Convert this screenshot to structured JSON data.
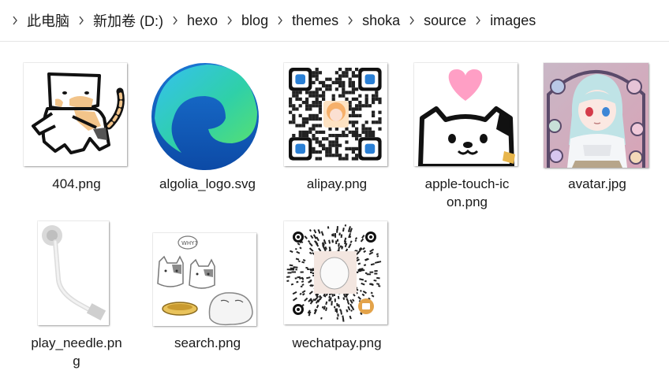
{
  "breadcrumb": [
    "此电脑",
    "新加卷 (D:)",
    "hexo",
    "blog",
    "themes",
    "shoka",
    "source",
    "images"
  ],
  "files": [
    {
      "name": "404.png"
    },
    {
      "name": "algolia_logo.svg"
    },
    {
      "name": "alipay.png"
    },
    {
      "name_line1": "apple-touch-ic",
      "name_line2": "on.png"
    },
    {
      "name": "avatar.jpg"
    },
    {
      "name_line1": "play_needle.pn",
      "name_line2": "g"
    },
    {
      "name": "search.png"
    },
    {
      "name": "wechatpay.png"
    }
  ],
  "thumb_text": {
    "whyq": "WHY?"
  },
  "colors": {
    "heart": "#ff9fc5",
    "qr_center_badge": "#e3a34a"
  }
}
